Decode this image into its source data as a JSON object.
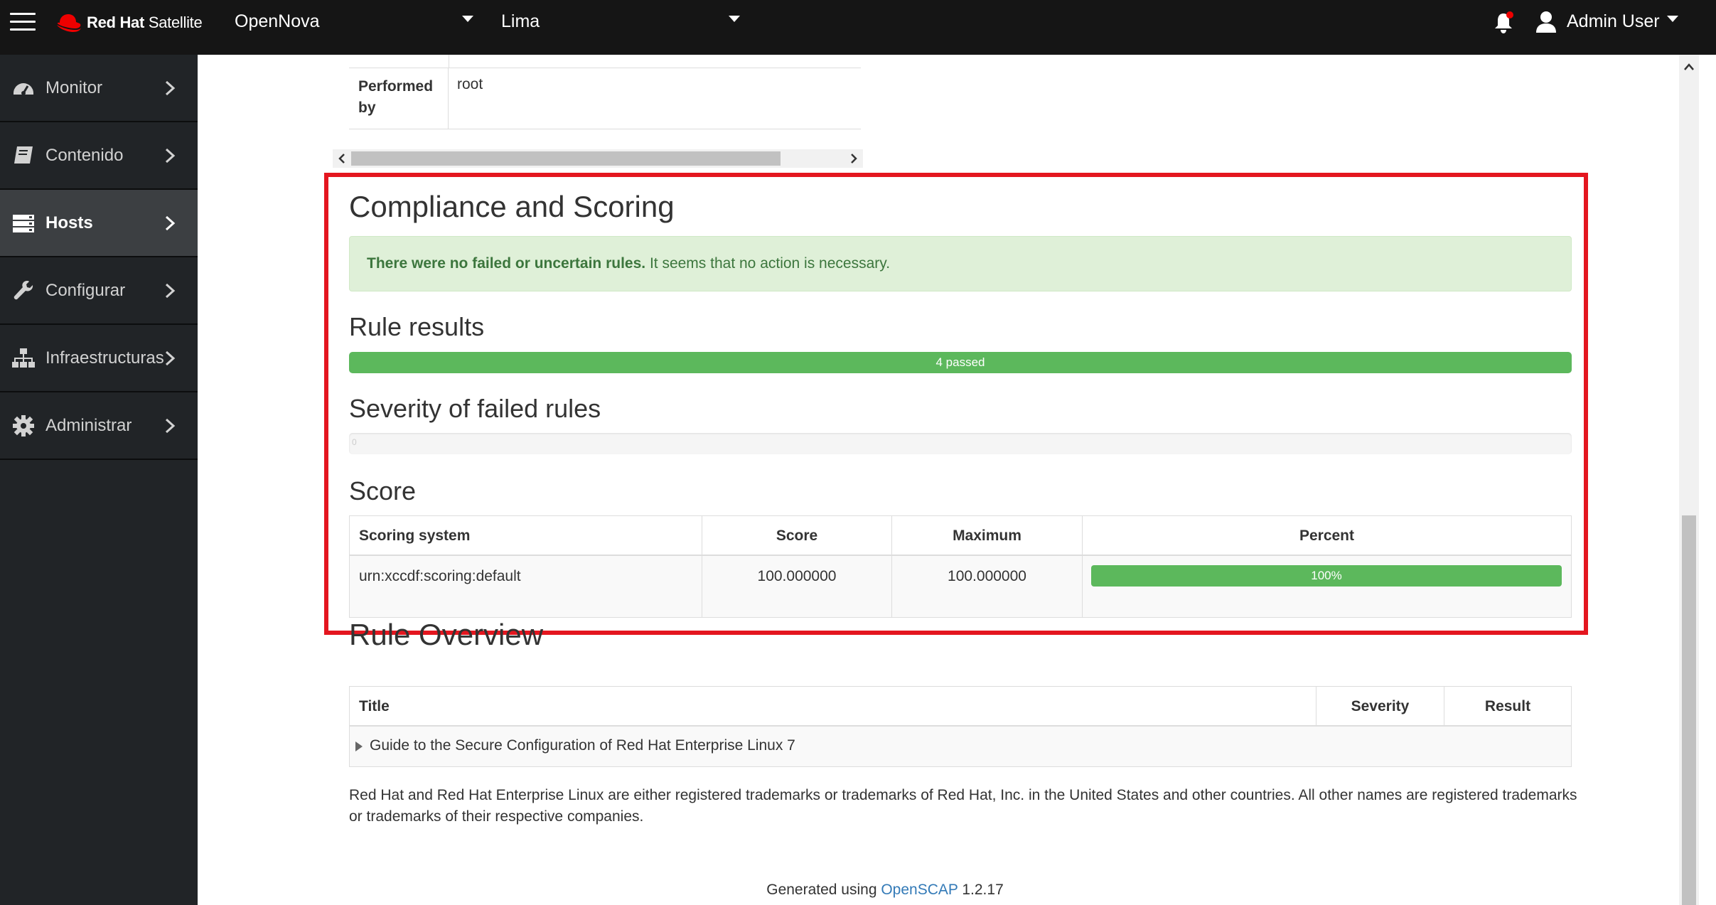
{
  "topbar": {
    "brand_bold": "Red Hat",
    "brand_rest": " Satellite",
    "organization": "OpenNova",
    "location": "Lima",
    "user": "Admin User"
  },
  "sidebar": {
    "items": [
      {
        "label": "Monitor",
        "icon": "dashboard-icon"
      },
      {
        "label": "Contenido",
        "icon": "book-icon"
      },
      {
        "label": "Hosts",
        "icon": "server-icon"
      },
      {
        "label": "Configurar",
        "icon": "wrench-icon"
      },
      {
        "label": "Infraestructuras",
        "icon": "network-icon"
      },
      {
        "label": "Administrar",
        "icon": "gear-icon"
      }
    ],
    "active": "Hosts"
  },
  "main": {
    "performed_by_label": "Performed by",
    "performed_by_value": "root",
    "compliance_title": "Compliance and Scoring",
    "alert_bold": "There were no failed or uncertain rules.",
    "alert_rest": " It seems that no action is necessary.",
    "rule_results_title": "Rule results",
    "rule_results_bar": "4 passed",
    "rule_results_pass_fraction": 1.0,
    "severity_title": "Severity of failed rules",
    "severity_empty_label": "0",
    "score_title": "Score",
    "score_table": {
      "headers": [
        "Scoring system",
        "Score",
        "Maximum",
        "Percent"
      ],
      "rows": [
        {
          "system": "urn:xccdf:scoring:default",
          "score": "100.000000",
          "maximum": "100.000000",
          "percent": "100%"
        }
      ]
    },
    "overview_title": "Rule Overview",
    "overview_table": {
      "headers": [
        "Title",
        "Severity",
        "Result"
      ],
      "rows": [
        {
          "title": "Guide to the Secure Configuration of Red Hat Enterprise Linux 7"
        }
      ]
    },
    "trademark_text": "Red Hat and Red Hat Enterprise Linux are either registered trademarks or trademarks of Red Hat, Inc. in the United States and other countries. All other names are registered trademarks or trademarks of their respective companies.",
    "generated_prefix": "Generated using ",
    "generated_link": "OpenSCAP",
    "generated_version": " 1.2.17"
  },
  "colors": {
    "topbar": "#151515",
    "sidebar": "#212427",
    "highlight": "#e4161f",
    "success": "#5cb85c",
    "link": "#337ab7"
  }
}
